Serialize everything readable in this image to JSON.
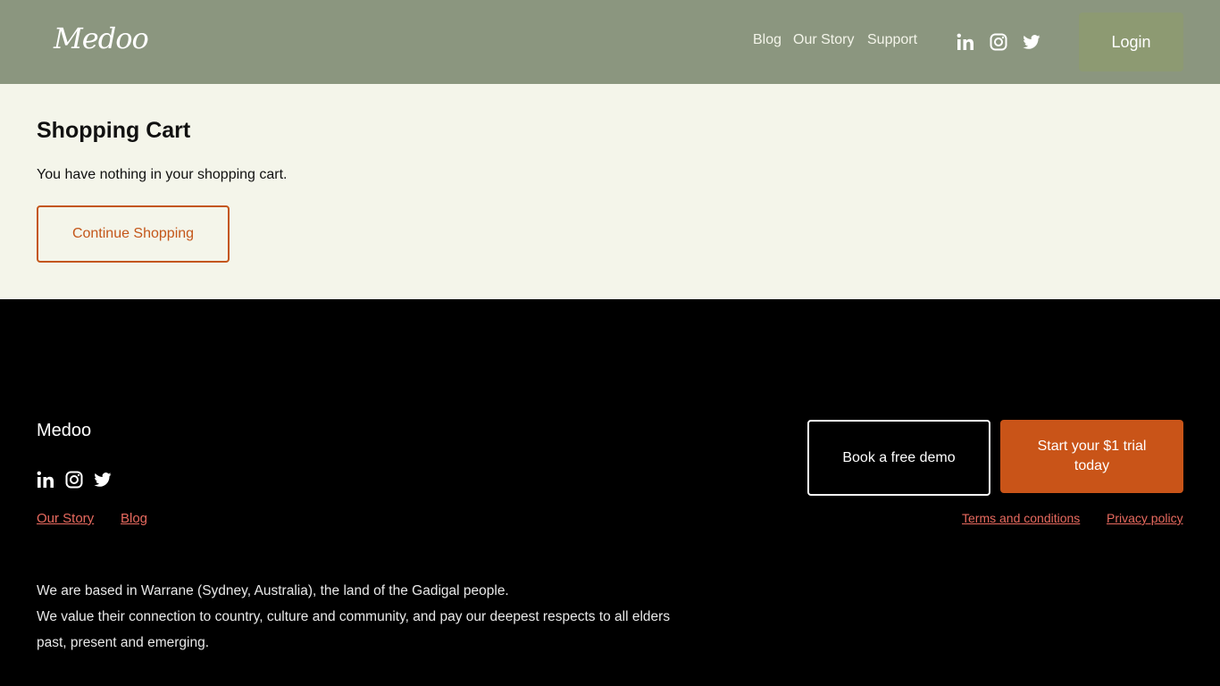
{
  "header": {
    "logo": "Medoo",
    "nav": [
      "Blog",
      "Our Story",
      "Support"
    ],
    "social": [
      "linkedin-icon",
      "instagram-icon",
      "twitter-icon"
    ],
    "login_label": "Login"
  },
  "cart": {
    "title": "Shopping Cart",
    "empty_message": "You have nothing in your shopping cart.",
    "continue_label": "Continue Shopping"
  },
  "footer": {
    "brand": "Medoo",
    "links_left": [
      "Our Story",
      "Blog"
    ],
    "demo_label": "Book a free demo",
    "trial_label": "Start your $1 trial today",
    "links_right": [
      "Terms and conditions",
      "Privacy policy"
    ],
    "acknowledgement_1": "We are based in Warrane (Sydney, Australia), the land of the Gadigal people.",
    "acknowledgement_2": "We value their connection to country, culture and community, and pay our deepest respects to all elders past, present and emerging."
  },
  "colors": {
    "header_bg": "#8b967f",
    "login_bg": "#8d9a72",
    "content_bg": "#f4f5ea",
    "accent": "#c45619",
    "footer_link": "#e86a5f"
  }
}
